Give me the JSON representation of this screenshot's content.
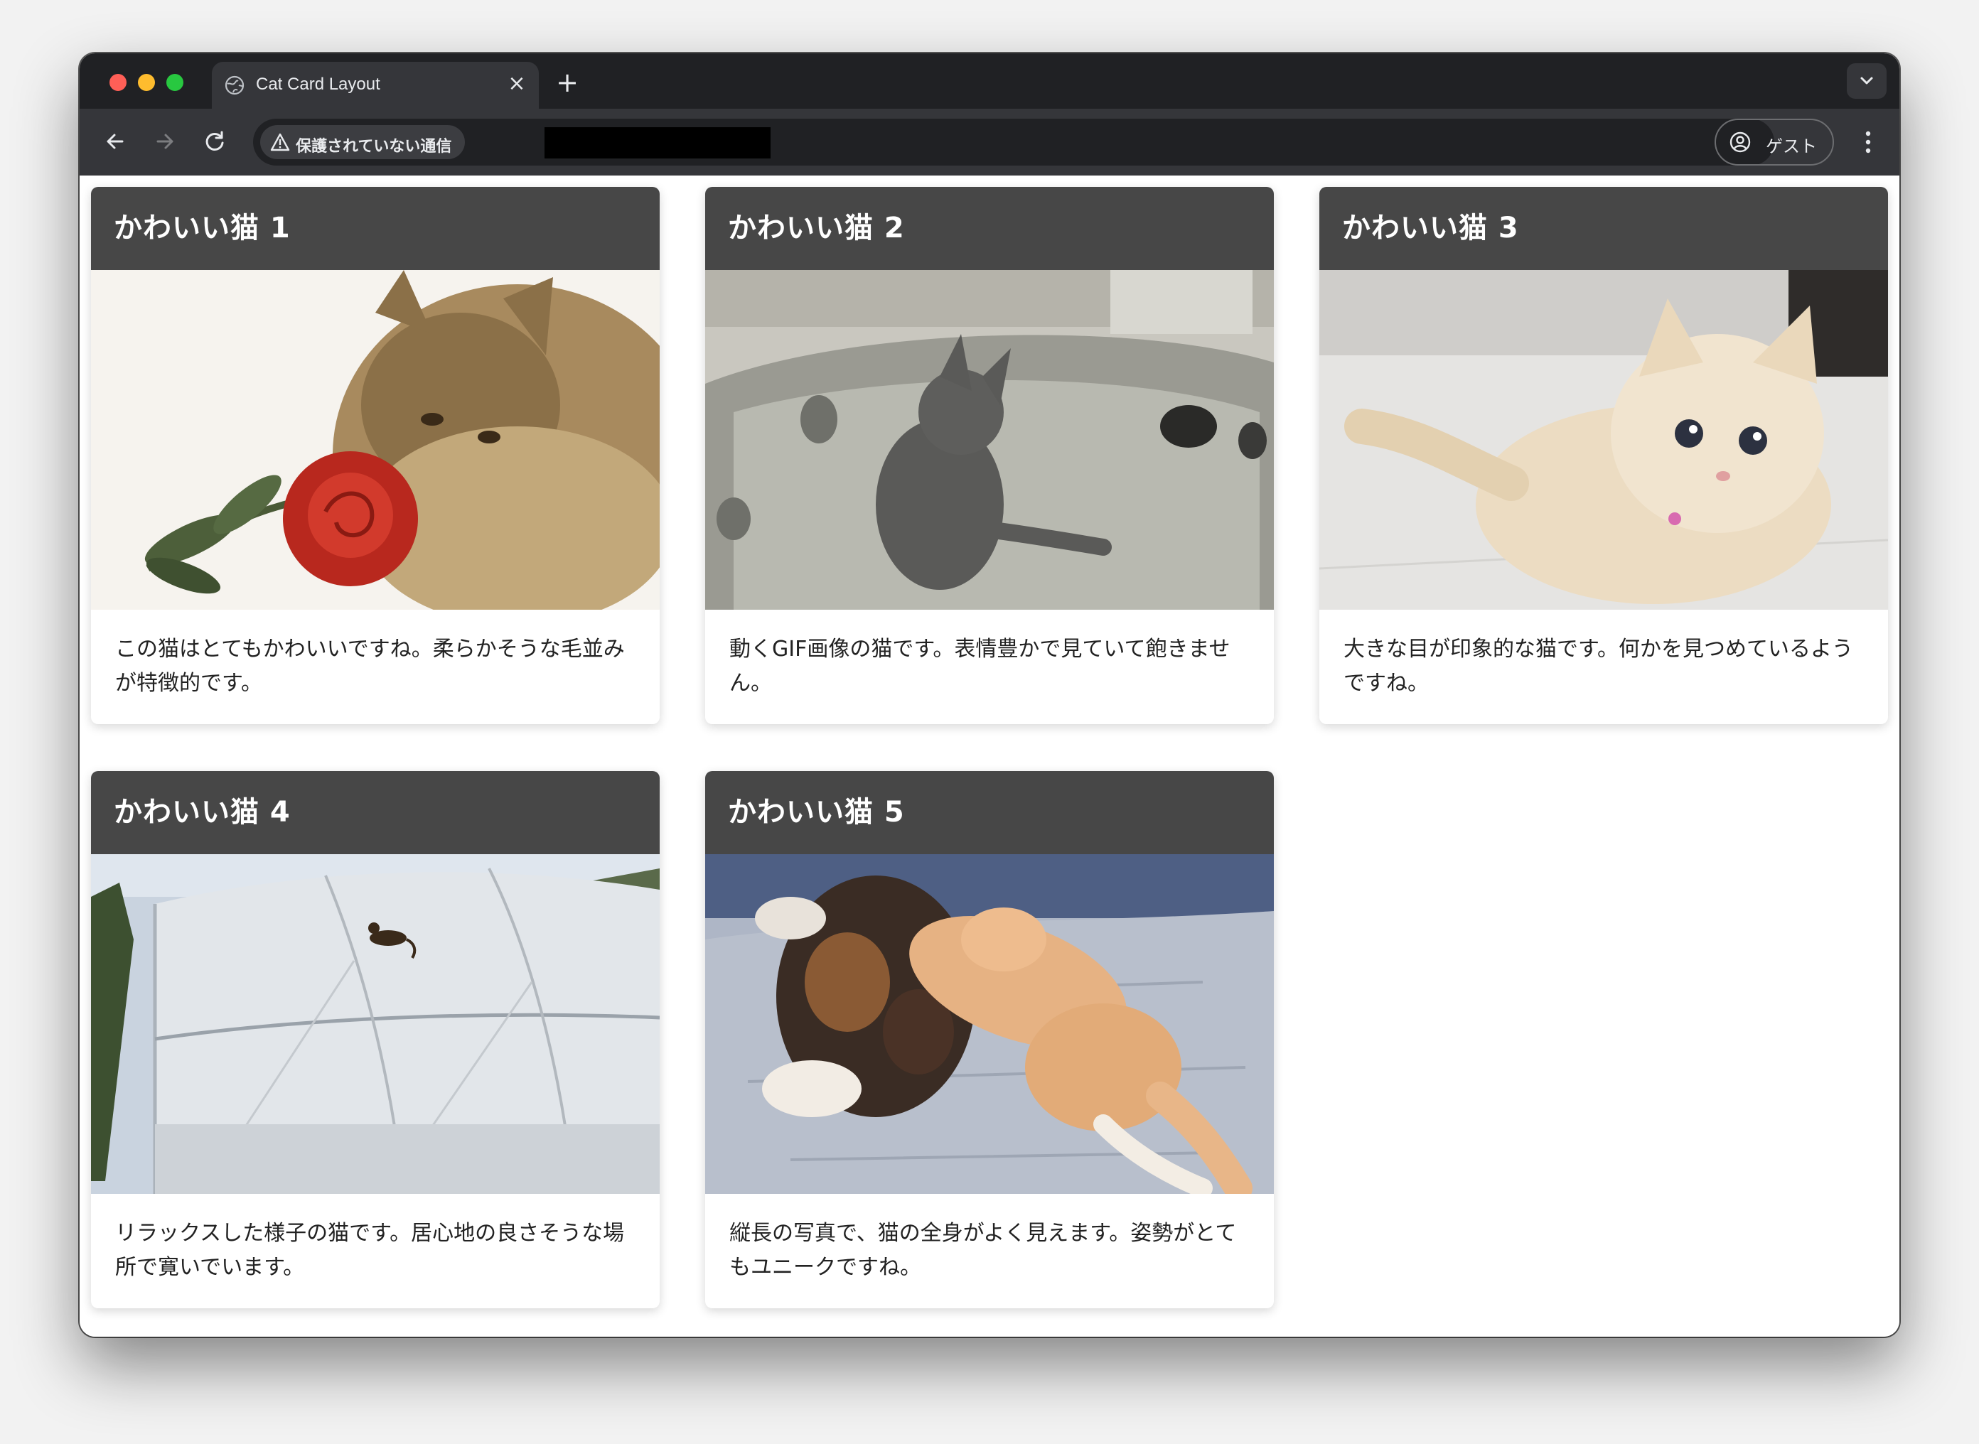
{
  "browser": {
    "tab_title": "Cat Card Layout",
    "tab_close": "×",
    "new_tab": "+",
    "security_label": "保護されていない通信",
    "profile_label": "ゲスト"
  },
  "cards": [
    {
      "title": "かわいい猫 1",
      "description": "この猫はとてもかわいいですね。柔らかそうな毛並みが特徴的です。",
      "image": "Cat with a red rose"
    },
    {
      "title": "かわいい猫 2",
      "description": "動くGIF画像の猫です。表情豊かで見ていて飽きません。",
      "image": "Cat in a bathtub"
    },
    {
      "title": "かわいい猫 3",
      "description": "大きな目が印象的な猫です。何かを見つめているようですね。",
      "image": "Fluffy cream kitten"
    },
    {
      "title": "かわいい猫 4",
      "description": "リラックスした様子の猫です。居心地の良さそうな場所で寛いでいます。",
      "image": "Cat on a greenhouse roof"
    },
    {
      "title": "かわいい猫 5",
      "description": "縦長の写真で、猫の全身がよく見えます。姿勢がとてもユニークですね。",
      "image": "Two cats lying on a bed"
    }
  ]
}
